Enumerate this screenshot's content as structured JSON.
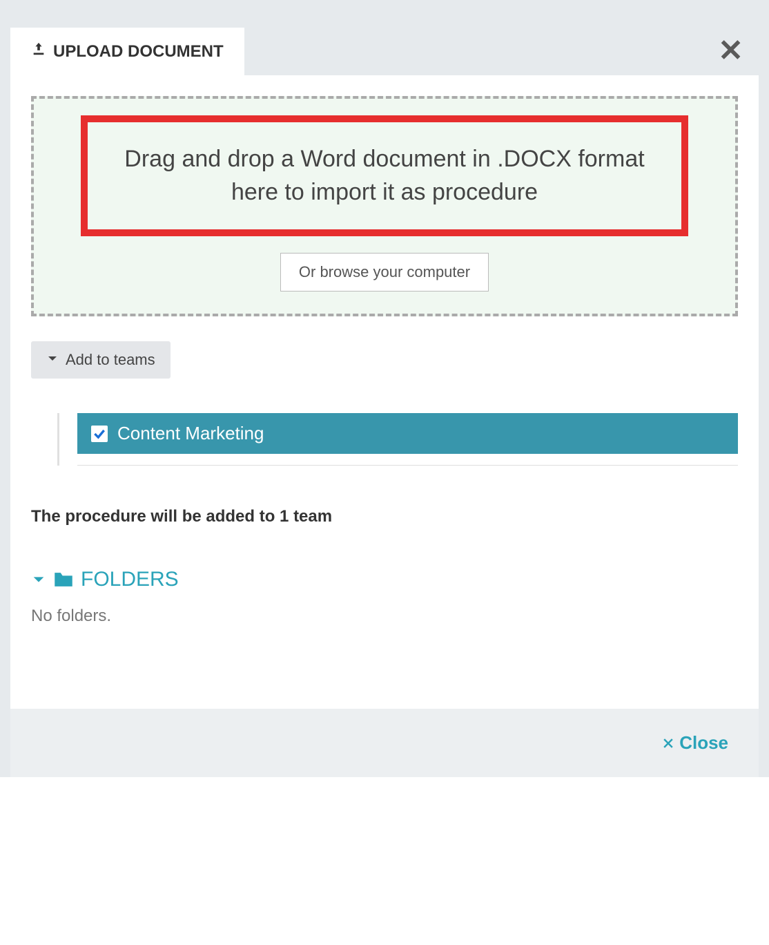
{
  "header": {
    "tab_label": " UPLOAD DOCUMENT"
  },
  "dropzone": {
    "drop_text": "Drag and drop a Word document in .DOCX format here to import it as procedure",
    "browse_label": "Or browse your computer"
  },
  "teams": {
    "collapsible_label": "Add to teams",
    "items": [
      {
        "label": "Content Marketing",
        "checked": true
      }
    ]
  },
  "summary": {
    "text": "The procedure will be added to 1 team"
  },
  "folders": {
    "header_label": "FOLDERS",
    "empty_text": "No folders."
  },
  "footer": {
    "close_label": "Close"
  }
}
